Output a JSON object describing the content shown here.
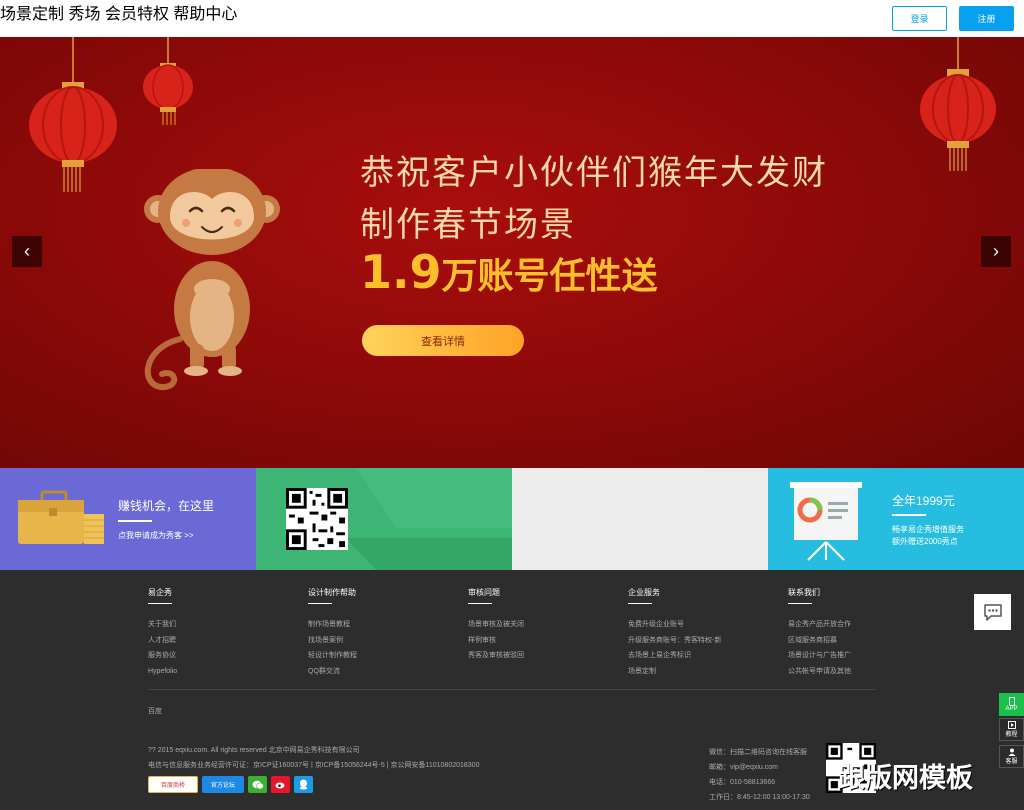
{
  "nav": {
    "items": [
      "场景定制",
      "秀场",
      "会员特权",
      "帮助中心"
    ],
    "login": "登录",
    "register": "注册"
  },
  "banner": {
    "line1": "恭祝客户小伙伴们猴年大发财",
    "line2": "制作春节场景",
    "line3_num": "1.9",
    "line3_text": "万账号任性送",
    "cta": "查看详情",
    "prev": "‹",
    "next": "›"
  },
  "promos": {
    "p1_title": "赚钱机会，在这里",
    "p1_sub": "点我申请成为秀客 >>",
    "p4_title": "全年1999元",
    "p4_sub1": "畅享易企秀增值服务",
    "p4_sub2": "额外赠送2000秀点"
  },
  "footer": {
    "columns": [
      {
        "heading": "易企秀",
        "items": [
          "关于我们",
          "人才招聘",
          "服务协议",
          "Hypefolio"
        ]
      },
      {
        "heading": "设计制作帮助",
        "items": [
          "制作场景教程",
          "找场景案例",
          "轻设计制作教程",
          "QQ群交流"
        ]
      },
      {
        "heading": "审核问题",
        "items": [
          "场景审核及被关闭",
          "样例审核",
          "秀客及审核被驳回"
        ]
      },
      {
        "heading": "企业服务",
        "items": [
          "免费升级企业账号",
          "升级服务商账号：秀客特权-新",
          "去场景上易企秀标识",
          "场景定制"
        ]
      },
      {
        "heading": "联系我们",
        "items": [
          "易企秀产品开放合作",
          "区域服务商招募",
          "场景设计与广告推广",
          "公共帐号申请及其他"
        ]
      }
    ],
    "baidu": "百度",
    "copyright": "?? 2015 eqxiu.com. All rights reserved 北京中网易企秀科技有限公司",
    "license": "电信与信息服务业务经营许可证：京ICP证160037号 | 京ICP备15056244号-5 | 京公网安备11010802018300",
    "badges": [
      "百度商桥",
      "官方论坛",
      "微信",
      "微博",
      "QQ"
    ],
    "contact": [
      "微信：扫描二维码咨询在线客服",
      "邮箱：vip@eqxiu.com",
      "电话：010-58813666",
      "工作日：8:45-12:00 13:00-17:30"
    ],
    "watermark": "跟版网模板"
  },
  "side": {
    "app": "APP",
    "tutorial": "教程",
    "service": "客服"
  },
  "colors": {
    "accent": "#08a1ef",
    "banner_red": "#8f0a09",
    "promo1": "#6b69d6",
    "promo2": "#3db574",
    "promo3": "#ececec",
    "promo4": "#27bde0",
    "footer_bg": "#2d2d2d"
  }
}
